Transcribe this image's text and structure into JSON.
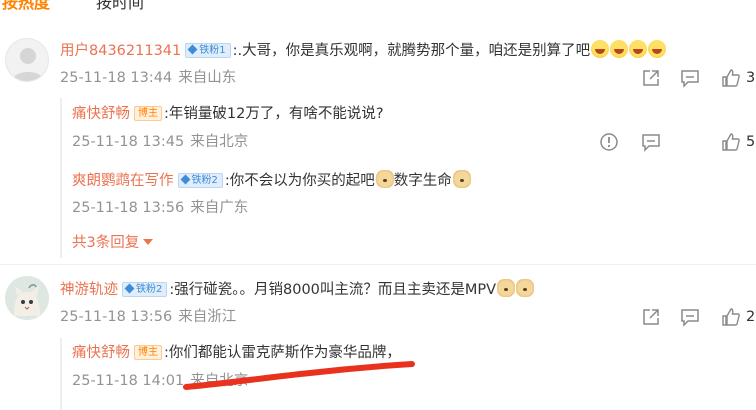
{
  "tabs": [
    {
      "label": "按热度",
      "active": true
    },
    {
      "label": "按时间",
      "active": false
    }
  ],
  "comments": [
    {
      "user": "用户8436211341",
      "badge": "铁粉1",
      "text": ":.大哥，你是真乐观啊，就腾势那个量，咱还是别算了吧",
      "emojis": [
        "laugh-emoji",
        "laugh-emoji",
        "laugh-emoji",
        "laugh-emoji"
      ],
      "time": "25-11-18 13:44",
      "location": "来自山东",
      "likes": "3",
      "replies": [
        {
          "user": "痛快舒畅",
          "badge": "博主",
          "text": ":年销量破12万了，有啥不能说说?",
          "time": "25-11-18 13:45",
          "location": "来自北京",
          "likes": "5"
        },
        {
          "user": "爽朗鹦鹉在写作",
          "badge": "铁粉2",
          "text_before": ":你不会以为你买的起吧",
          "text_after": "数字生命",
          "time": "25-11-18 13:56",
          "location": "来自广东"
        }
      ],
      "more_replies": "共3条回复"
    },
    {
      "user": "神游轨迹",
      "badge": "铁粉2",
      "text": ":强行碰瓷。。月销8000叫主流？而且主卖还是MPV",
      "time": "25-11-18 13:56",
      "location": "来自浙江",
      "likes": "2",
      "replies": [
        {
          "user": "痛快舒畅",
          "badge": "博主",
          "text": ":你们都能认雷克萨斯作为豪华品牌，",
          "time": "25-11-18 14:01",
          "location": "来自北京"
        }
      ]
    }
  ],
  "colors": {
    "accent": "#ff8200",
    "username": "#eb7350",
    "meta": "#939393",
    "annotation_stroke": "#e8321e"
  }
}
